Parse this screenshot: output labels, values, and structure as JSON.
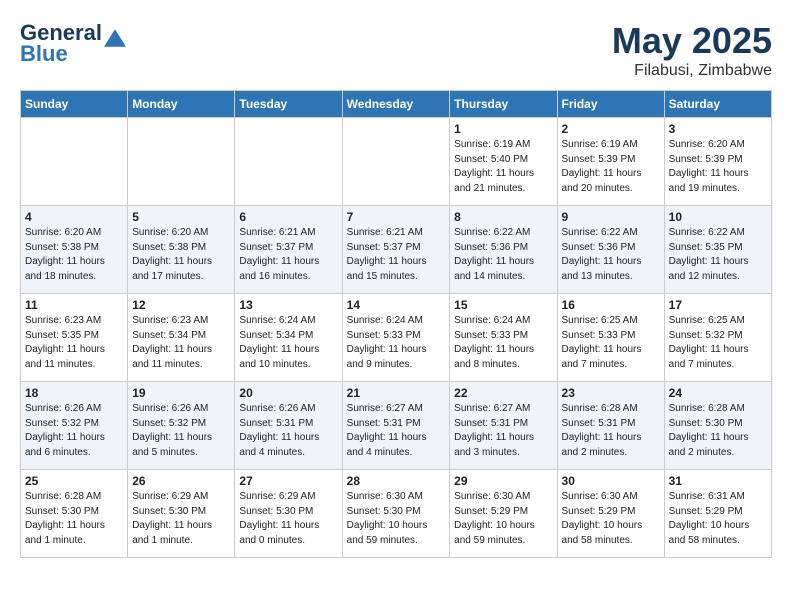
{
  "header": {
    "logo_line1": "General",
    "logo_line2": "Blue",
    "month": "May 2025",
    "location": "Filabusi, Zimbabwe"
  },
  "weekdays": [
    "Sunday",
    "Monday",
    "Tuesday",
    "Wednesday",
    "Thursday",
    "Friday",
    "Saturday"
  ],
  "weeks": [
    [
      {
        "day": "",
        "info": ""
      },
      {
        "day": "",
        "info": ""
      },
      {
        "day": "",
        "info": ""
      },
      {
        "day": "",
        "info": ""
      },
      {
        "day": "1",
        "info": "Sunrise: 6:19 AM\nSunset: 5:40 PM\nDaylight: 11 hours\nand 21 minutes."
      },
      {
        "day": "2",
        "info": "Sunrise: 6:19 AM\nSunset: 5:39 PM\nDaylight: 11 hours\nand 20 minutes."
      },
      {
        "day": "3",
        "info": "Sunrise: 6:20 AM\nSunset: 5:39 PM\nDaylight: 11 hours\nand 19 minutes."
      }
    ],
    [
      {
        "day": "4",
        "info": "Sunrise: 6:20 AM\nSunset: 5:38 PM\nDaylight: 11 hours\nand 18 minutes."
      },
      {
        "day": "5",
        "info": "Sunrise: 6:20 AM\nSunset: 5:38 PM\nDaylight: 11 hours\nand 17 minutes."
      },
      {
        "day": "6",
        "info": "Sunrise: 6:21 AM\nSunset: 5:37 PM\nDaylight: 11 hours\nand 16 minutes."
      },
      {
        "day": "7",
        "info": "Sunrise: 6:21 AM\nSunset: 5:37 PM\nDaylight: 11 hours\nand 15 minutes."
      },
      {
        "day": "8",
        "info": "Sunrise: 6:22 AM\nSunset: 5:36 PM\nDaylight: 11 hours\nand 14 minutes."
      },
      {
        "day": "9",
        "info": "Sunrise: 6:22 AM\nSunset: 5:36 PM\nDaylight: 11 hours\nand 13 minutes."
      },
      {
        "day": "10",
        "info": "Sunrise: 6:22 AM\nSunset: 5:35 PM\nDaylight: 11 hours\nand 12 minutes."
      }
    ],
    [
      {
        "day": "11",
        "info": "Sunrise: 6:23 AM\nSunset: 5:35 PM\nDaylight: 11 hours\nand 11 minutes."
      },
      {
        "day": "12",
        "info": "Sunrise: 6:23 AM\nSunset: 5:34 PM\nDaylight: 11 hours\nand 11 minutes."
      },
      {
        "day": "13",
        "info": "Sunrise: 6:24 AM\nSunset: 5:34 PM\nDaylight: 11 hours\nand 10 minutes."
      },
      {
        "day": "14",
        "info": "Sunrise: 6:24 AM\nSunset: 5:33 PM\nDaylight: 11 hours\nand 9 minutes."
      },
      {
        "day": "15",
        "info": "Sunrise: 6:24 AM\nSunset: 5:33 PM\nDaylight: 11 hours\nand 8 minutes."
      },
      {
        "day": "16",
        "info": "Sunrise: 6:25 AM\nSunset: 5:33 PM\nDaylight: 11 hours\nand 7 minutes."
      },
      {
        "day": "17",
        "info": "Sunrise: 6:25 AM\nSunset: 5:32 PM\nDaylight: 11 hours\nand 7 minutes."
      }
    ],
    [
      {
        "day": "18",
        "info": "Sunrise: 6:26 AM\nSunset: 5:32 PM\nDaylight: 11 hours\nand 6 minutes."
      },
      {
        "day": "19",
        "info": "Sunrise: 6:26 AM\nSunset: 5:32 PM\nDaylight: 11 hours\nand 5 minutes."
      },
      {
        "day": "20",
        "info": "Sunrise: 6:26 AM\nSunset: 5:31 PM\nDaylight: 11 hours\nand 4 minutes."
      },
      {
        "day": "21",
        "info": "Sunrise: 6:27 AM\nSunset: 5:31 PM\nDaylight: 11 hours\nand 4 minutes."
      },
      {
        "day": "22",
        "info": "Sunrise: 6:27 AM\nSunset: 5:31 PM\nDaylight: 11 hours\nand 3 minutes."
      },
      {
        "day": "23",
        "info": "Sunrise: 6:28 AM\nSunset: 5:31 PM\nDaylight: 11 hours\nand 2 minutes."
      },
      {
        "day": "24",
        "info": "Sunrise: 6:28 AM\nSunset: 5:30 PM\nDaylight: 11 hours\nand 2 minutes."
      }
    ],
    [
      {
        "day": "25",
        "info": "Sunrise: 6:28 AM\nSunset: 5:30 PM\nDaylight: 11 hours\nand 1 minute."
      },
      {
        "day": "26",
        "info": "Sunrise: 6:29 AM\nSunset: 5:30 PM\nDaylight: 11 hours\nand 1 minute."
      },
      {
        "day": "27",
        "info": "Sunrise: 6:29 AM\nSunset: 5:30 PM\nDaylight: 11 hours\nand 0 minutes."
      },
      {
        "day": "28",
        "info": "Sunrise: 6:30 AM\nSunset: 5:30 PM\nDaylight: 10 hours\nand 59 minutes."
      },
      {
        "day": "29",
        "info": "Sunrise: 6:30 AM\nSunset: 5:29 PM\nDaylight: 10 hours\nand 59 minutes."
      },
      {
        "day": "30",
        "info": "Sunrise: 6:30 AM\nSunset: 5:29 PM\nDaylight: 10 hours\nand 58 minutes."
      },
      {
        "day": "31",
        "info": "Sunrise: 6:31 AM\nSunset: 5:29 PM\nDaylight: 10 hours\nand 58 minutes."
      }
    ]
  ]
}
